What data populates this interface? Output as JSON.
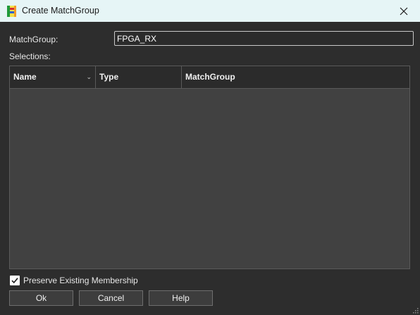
{
  "window": {
    "title": "Create MatchGroup",
    "app_icon": "matchgroup-app-icon",
    "close_icon": "close-icon"
  },
  "form": {
    "matchgroup_label": "MatchGroup:",
    "matchgroup_value": "FPGA_RX",
    "selections_label": "Selections:"
  },
  "table": {
    "columns": [
      {
        "label": "Name",
        "sort_icon": "chevron-down-icon"
      },
      {
        "label": "Type"
      },
      {
        "label": "MatchGroup"
      }
    ],
    "rows": []
  },
  "options": {
    "preserve_label": "Preserve Existing Membership",
    "preserve_checked": true
  },
  "buttons": {
    "ok": "Ok",
    "cancel": "Cancel",
    "help": "Help"
  },
  "colors": {
    "titlebar_bg": "#e6f5f6",
    "dialog_bg": "#2d2d2d",
    "table_body_bg": "#414141",
    "table_header_bg": "#2b2b2b"
  }
}
